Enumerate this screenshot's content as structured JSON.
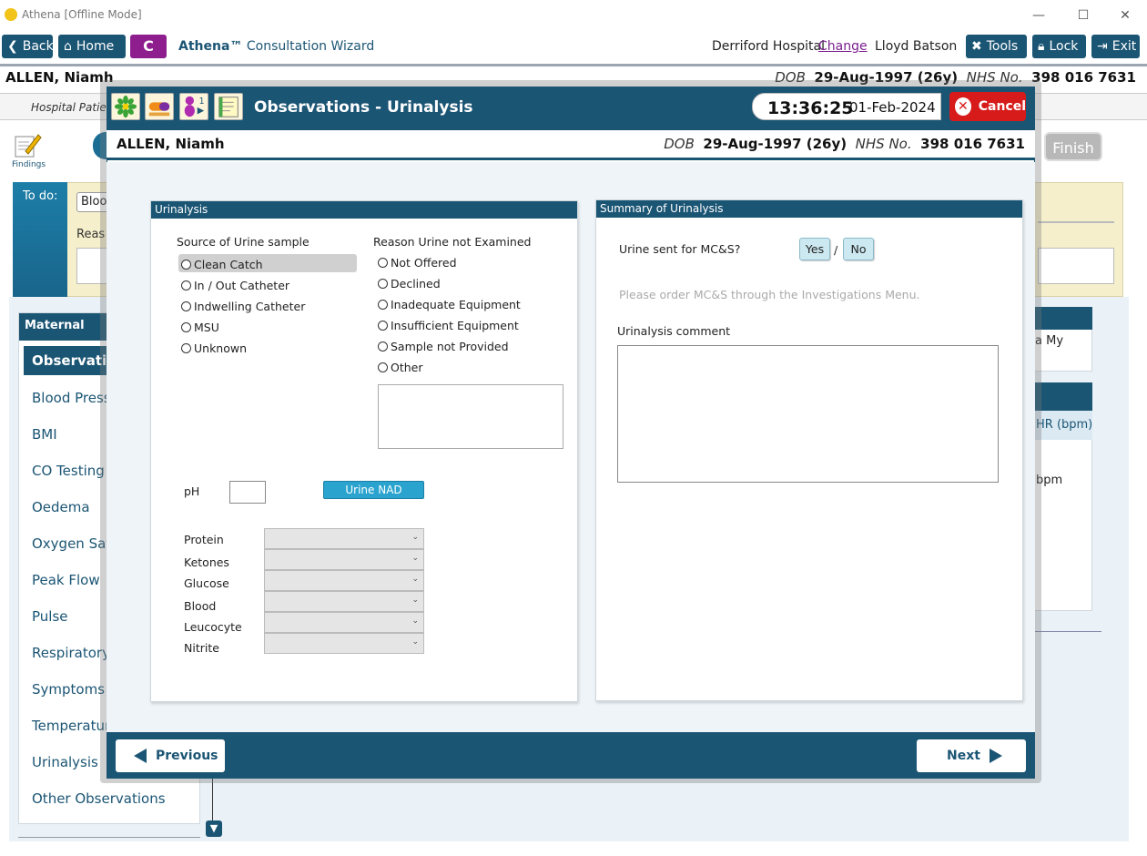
{
  "window": {
    "title": "Athena [Offline Mode]",
    "minimize": "—",
    "maximize": "☐",
    "close": "✕"
  },
  "toolbar": {
    "back_label": "Back",
    "home_label": "Home",
    "c_label": "C",
    "wizard_brand": "Athena™",
    "wizard_title": " Consultation Wizard",
    "hospital": "Derriford Hospital",
    "change_label": "Change",
    "user": "Lloyd Batson",
    "tools_label": "Tools",
    "lock_label": "Lock",
    "exit_label": "Exit"
  },
  "background": {
    "patient_name": "ALLEN, Niamh",
    "dob_label": "DOB",
    "dob": "29-Aug-1997 (26y)",
    "nhs_label": "NHS No.",
    "nhs": "398 016 7631",
    "sub_text": "Hospital Patie",
    "findings_label": "Findings",
    "finish_label": "Finish",
    "todo_label": "To do:",
    "todo_field": "Bloo",
    "todo_reason": "Reas",
    "sidebar_header": "Maternal",
    "sidebar_items": [
      "Observation",
      "Blood Press",
      "BMI",
      "CO Testing",
      "Oedema",
      "Oxygen Sat",
      "Peak Flow",
      "Pulse",
      "Respiratory",
      "Symptoms",
      "Temperatur",
      "Urinalysis",
      "Other Observations"
    ],
    "right_top_text": "a My",
    "right_col_text": "HR (bpm)",
    "right_val_text": "bpm"
  },
  "modal": {
    "title": "Observations - Urinalysis",
    "time": "13:36:25",
    "date": "01-Feb-2024",
    "cancel_label": "Cancel",
    "patient_name": "ALLEN, Niamh",
    "dob_label": "DOB",
    "dob": "29-Aug-1997 (26y)",
    "nhs_label": "NHS No.",
    "nhs": "398 016 7631",
    "urinalysis_panel": {
      "title": "Urinalysis",
      "source_label": "Source of Urine sample",
      "source_options": [
        "Clean Catch",
        "In / Out Catheter",
        "Indwelling Catheter",
        "MSU",
        "Unknown"
      ],
      "source_selected": "Clean Catch",
      "reason_label": "Reason Urine not Examined",
      "reason_options": [
        "Not Offered",
        "Declined",
        "Inadequate Equipment",
        "Insufficient Equipment",
        "Sample not Provided",
        "Other"
      ],
      "ph_label": "pH",
      "urine_nad_label": "Urine NAD",
      "tests": [
        "Protein",
        "Ketones",
        "Glucose",
        "Blood",
        "Leucocyte",
        "Nitrite"
      ]
    },
    "summary_panel": {
      "title": "Summary of Urinalysis",
      "mcs_question": "Urine sent for MC&S?",
      "yes_label": "Yes",
      "separator": "/",
      "no_label": "No",
      "mcs_hint": "Please order MC&S through the Investigations Menu.",
      "comment_label": "Urinalysis comment"
    },
    "footer": {
      "previous_label": "Previous",
      "next_label": "Next"
    }
  }
}
